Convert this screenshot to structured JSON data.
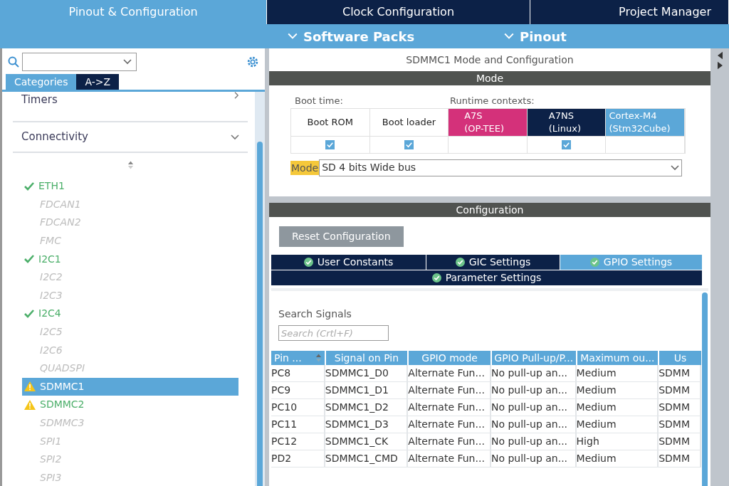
{
  "main_tabs": [
    {
      "label": "Pinout & Configuration",
      "selected": true
    },
    {
      "label": "Clock Configuration",
      "selected": false
    },
    {
      "label": "Project Manager",
      "selected": false
    }
  ],
  "sub_menu": [
    "Software Packs",
    "Pinout"
  ],
  "sidebar": {
    "view_tabs": [
      {
        "label": "Categories",
        "selected": true
      },
      {
        "label": "A->Z",
        "selected": false
      }
    ],
    "categories": [
      {
        "label": "Timers",
        "expanded": false
      },
      {
        "label": "Connectivity",
        "expanded": true
      }
    ],
    "items": [
      {
        "label": "ETH1",
        "kind": "ok",
        "selected": false
      },
      {
        "label": "FDCAN1",
        "kind": "disabled",
        "selected": false
      },
      {
        "label": "FDCAN2",
        "kind": "disabled",
        "selected": false
      },
      {
        "label": "FMC",
        "kind": "disabled",
        "selected": false
      },
      {
        "label": "I2C1",
        "kind": "ok",
        "selected": false
      },
      {
        "label": "I2C2",
        "kind": "disabled",
        "selected": false
      },
      {
        "label": "I2C3",
        "kind": "disabled",
        "selected": false
      },
      {
        "label": "I2C4",
        "kind": "ok",
        "selected": false
      },
      {
        "label": "I2C5",
        "kind": "disabled",
        "selected": false
      },
      {
        "label": "I2C6",
        "kind": "disabled",
        "selected": false
      },
      {
        "label": "QUADSPI",
        "kind": "disabled",
        "selected": false
      },
      {
        "label": "SDMMC1",
        "kind": "warning",
        "selected": true
      },
      {
        "label": "SDMMC2",
        "kind": "warning",
        "selected": false
      },
      {
        "label": "SDMMC3",
        "kind": "disabled",
        "selected": false
      },
      {
        "label": "SPI1",
        "kind": "disabled",
        "selected": false
      },
      {
        "label": "SPI2",
        "kind": "disabled",
        "selected": false
      },
      {
        "label": "SPI3",
        "kind": "disabled",
        "selected": false
      }
    ]
  },
  "panel": {
    "title": "SDMMC1 Mode and Configuration",
    "mode_header": "Mode",
    "boot_label": "Boot time:",
    "runtime_label": "Runtime contexts:",
    "contexts": [
      {
        "label": "Boot ROM",
        "color": "#ffffff",
        "checked": true
      },
      {
        "label": "Boot loader",
        "color": "#ffffff",
        "checked": true
      },
      {
        "label": "A7S\n(OP-TEE)",
        "color": "#d4317a",
        "checked": false
      },
      {
        "label": "A7NS\n(Linux)",
        "color": "#0c2147",
        "checked": true
      },
      {
        "label": "Cortex-M4\n(Stm32Cube)",
        "color": "#5ba7d8",
        "checked": false
      }
    ],
    "mode_label": "Mode",
    "mode_value": "SD 4 bits Wide bus",
    "config_header": "Configuration",
    "reset_button": "Reset Configuration",
    "config_tabs": [
      {
        "label": "User Constants",
        "selected": false
      },
      {
        "label": "GIC Settings",
        "selected": false
      },
      {
        "label": "GPIO Settings",
        "selected": true
      },
      {
        "label": "Parameter Settings",
        "selected": false
      }
    ],
    "search_label": "Search Signals",
    "search_placeholder": "Search (Crtl+F)",
    "table": {
      "columns": [
        "Pin ...",
        "Signal on Pin",
        "GPIO mode",
        "GPIO Pull-up/P...",
        "Maximum ou...",
        "Us"
      ],
      "rows": [
        [
          "PC8",
          "SDMMC1_D0",
          "Alternate Fun...",
          "No pull-up an...",
          "Medium",
          "SDMM"
        ],
        [
          "PC9",
          "SDMMC1_D1",
          "Alternate Fun...",
          "No pull-up an...",
          "Medium",
          "SDMM"
        ],
        [
          "PC10",
          "SDMMC1_D2",
          "Alternate Fun...",
          "No pull-up an...",
          "Medium",
          "SDMM"
        ],
        [
          "PC11",
          "SDMMC1_D3",
          "Alternate Fun...",
          "No pull-up an...",
          "Medium",
          "SDMM"
        ],
        [
          "PC12",
          "SDMMC1_CK",
          "Alternate Fun...",
          "No pull-up an...",
          "High",
          "SDMM"
        ],
        [
          "PD2",
          "SDMMC1_CMD",
          "Alternate Fun...",
          "No pull-up an...",
          "Medium",
          "SDMM"
        ]
      ]
    }
  }
}
